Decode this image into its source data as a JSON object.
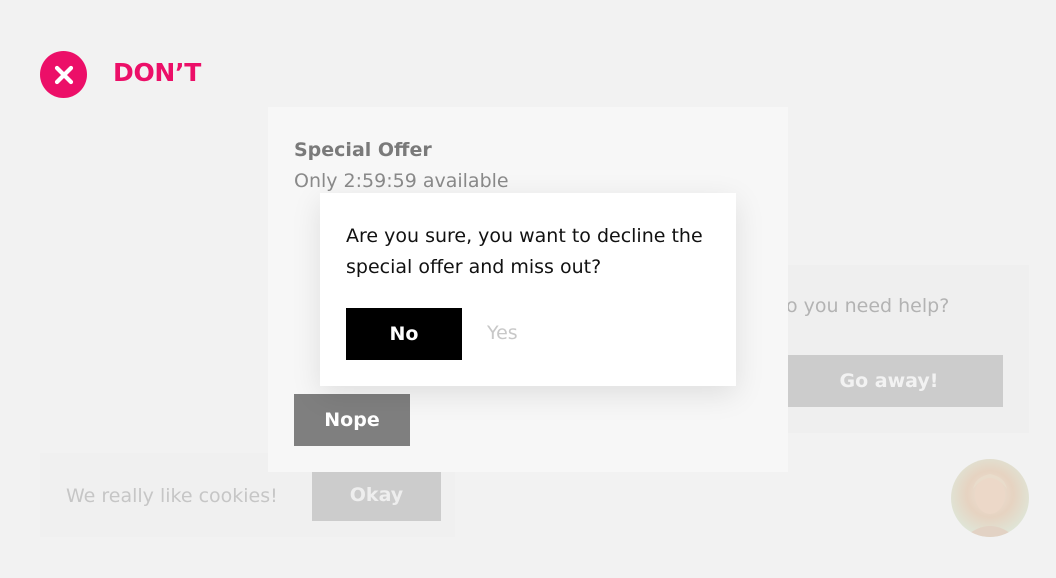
{
  "header": {
    "label": "DON’T",
    "icon": "close-circle-icon",
    "accent_color": "#ec0f68"
  },
  "offer_panel": {
    "title": "Special Offer",
    "timer": "Only 2:59:59 available",
    "dismiss_label": "Nope"
  },
  "dialog": {
    "message": "Are you sure, you want to decline the special offer and miss out?",
    "no_label": "No",
    "yes_label": "Yes"
  },
  "help_widget": {
    "text": "o you need help?",
    "button_label": "Go away!"
  },
  "cookie_bar": {
    "text": "We really like cookies!",
    "button_label": "Okay"
  },
  "chat": {
    "avatar": "person-avatar"
  }
}
